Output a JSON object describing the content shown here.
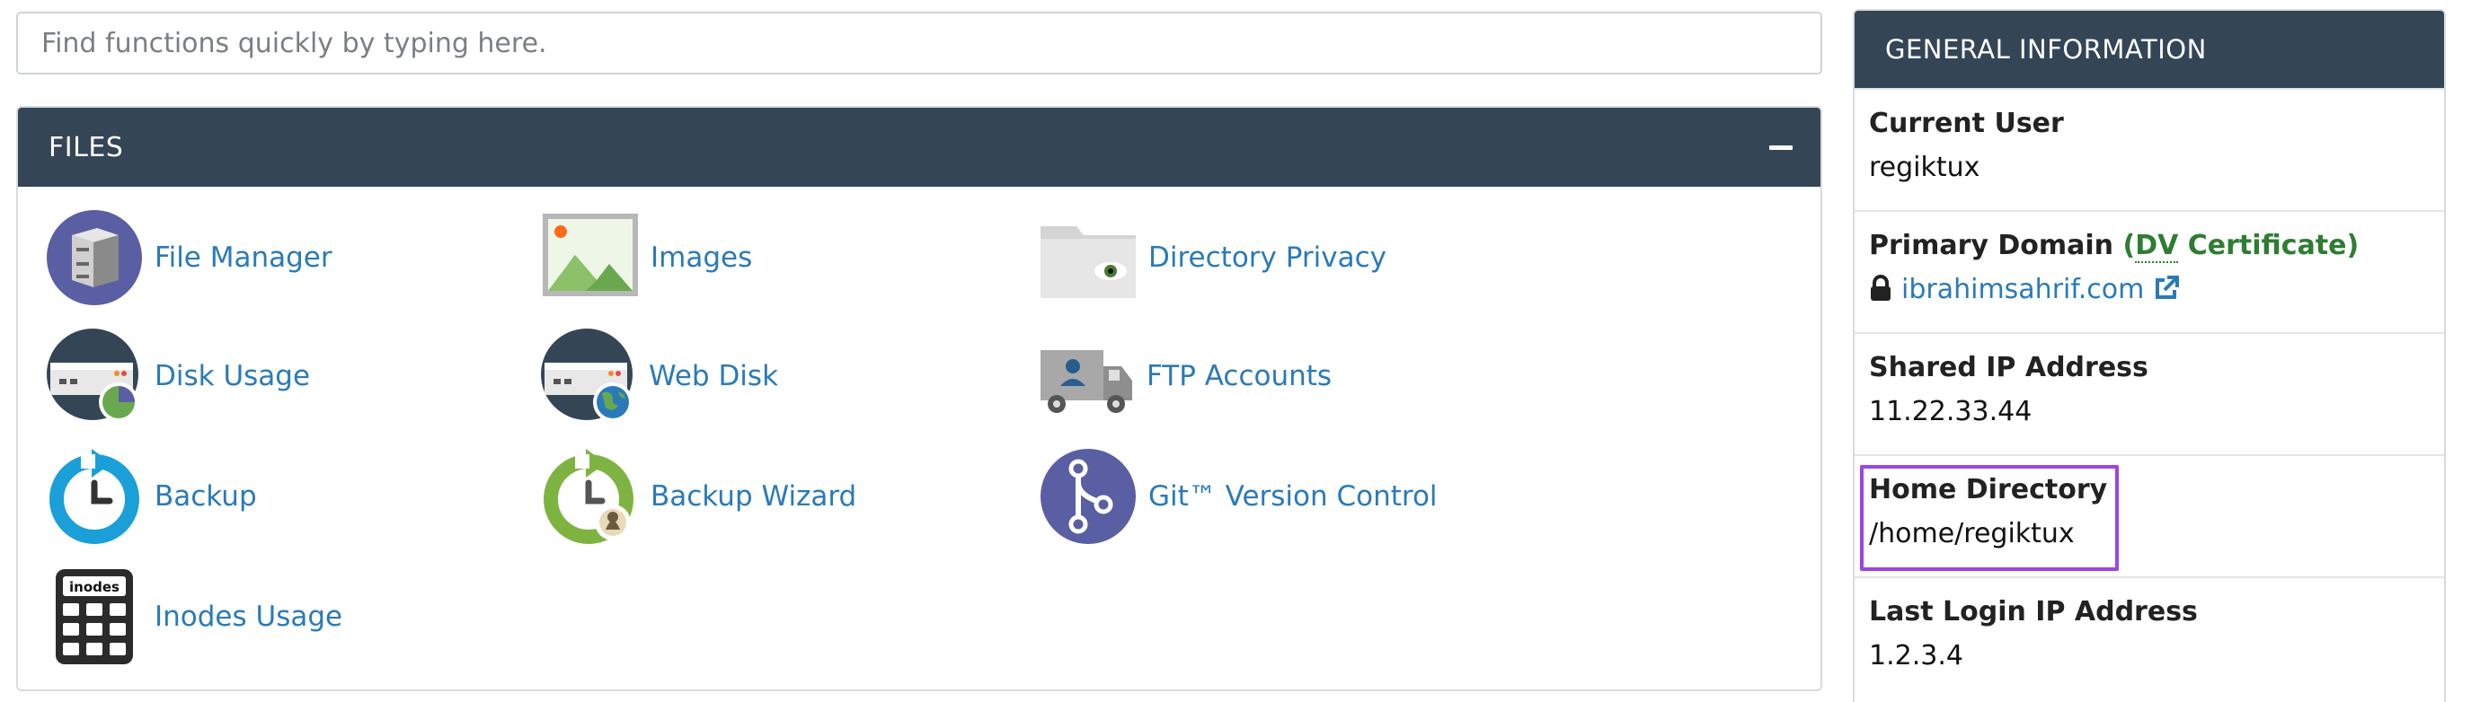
{
  "search": {
    "placeholder": "Find functions quickly by typing here."
  },
  "files": {
    "title": "FILES",
    "items": [
      {
        "label": "File Manager",
        "icon": "file-cabinet-icon"
      },
      {
        "label": "Images",
        "icon": "image-icon"
      },
      {
        "label": "Directory Privacy",
        "icon": "folder-eye-icon"
      },
      {
        "label": "Disk Usage",
        "icon": "disk-pie-icon"
      },
      {
        "label": "Web Disk",
        "icon": "disk-globe-icon"
      },
      {
        "label": "FTP Accounts",
        "icon": "ftp-truck-icon"
      },
      {
        "label": "Backup",
        "icon": "backup-clock-icon"
      },
      {
        "label": "Backup Wizard",
        "icon": "backup-wizard-icon"
      },
      {
        "label": "Git™ Version Control",
        "icon": "git-branch-icon"
      },
      {
        "label": "Inodes Usage",
        "icon": "inodes-calculator-icon"
      }
    ],
    "inodes_icon_text": "inodes"
  },
  "info": {
    "title": "GENERAL INFORMATION",
    "current_user_label": "Current User",
    "current_user_value": "regiktux",
    "primary_domain_label": "Primary Domain",
    "cert_open": "(",
    "cert_dv": "DV",
    "cert_rest": " Certificate)",
    "primary_domain_value": "ibrahimsahrif.com",
    "shared_ip_label": "Shared IP Address",
    "shared_ip_value": "11.22.33.44",
    "home_dir_label": "Home Directory",
    "home_dir_value": "/home/regiktux",
    "last_login_label": "Last Login IP Address",
    "last_login_value": "1.2.3.4"
  },
  "colors": {
    "header_bg": "#344556",
    "link": "#2a7ab9",
    "cert_green": "#2e7d32",
    "highlight": "#9b45e4"
  }
}
